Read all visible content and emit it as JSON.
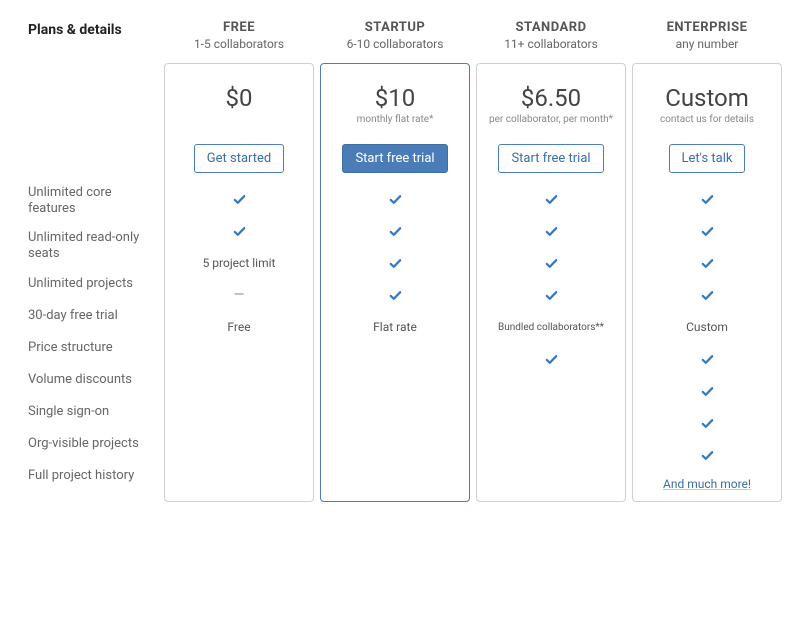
{
  "heading": "Plans & details",
  "plans": [
    {
      "id": "free",
      "name": "FREE",
      "subtitle": "1-5 collaborators",
      "price": "$0",
      "price_caption": "",
      "cta": "Get started",
      "cta_style": "outline",
      "highlight": false
    },
    {
      "id": "startup",
      "name": "STARTUP",
      "subtitle": "6-10 collaborators",
      "price": "$10",
      "price_caption": "monthly flat rate*",
      "cta": "Start free trial",
      "cta_style": "primary",
      "highlight": true
    },
    {
      "id": "standard",
      "name": "STANDARD",
      "subtitle": "11+ collaborators",
      "price": "$6.50",
      "price_caption": "per collaborator, per month*",
      "cta": "Start free trial",
      "cta_style": "outline",
      "highlight": false
    },
    {
      "id": "enterprise",
      "name": "ENTERPRISE",
      "subtitle": "any number",
      "price": "Custom",
      "price_caption": "contact us for details",
      "cta": "Let's talk",
      "cta_style": "outline",
      "highlight": false
    }
  ],
  "rows": [
    {
      "label": "Unlimited core features",
      "cells": [
        "check",
        "check",
        "check",
        "check"
      ]
    },
    {
      "label": "Unlimited read-only seats",
      "cells": [
        "check",
        "check",
        "check",
        "check"
      ]
    },
    {
      "label": "Unlimited projects",
      "cells": [
        "5 project limit",
        "check",
        "check",
        "check"
      ]
    },
    {
      "label": "30-day free trial",
      "cells": [
        "—",
        "check",
        "check",
        "check"
      ]
    },
    {
      "label": "Price structure",
      "cells": [
        "Free",
        "Flat rate",
        "Bundled collaborators**",
        "Custom"
      ]
    },
    {
      "label": "Volume discounts",
      "cells": [
        "",
        "",
        "check",
        "check"
      ]
    },
    {
      "label": "Single sign-on",
      "cells": [
        "",
        "",
        "",
        "check"
      ]
    },
    {
      "label": "Org-visible projects",
      "cells": [
        "",
        "",
        "",
        "check"
      ]
    },
    {
      "label": "Full project history",
      "cells": [
        "",
        "",
        "",
        "check"
      ]
    }
  ],
  "more_link": "And much more!"
}
